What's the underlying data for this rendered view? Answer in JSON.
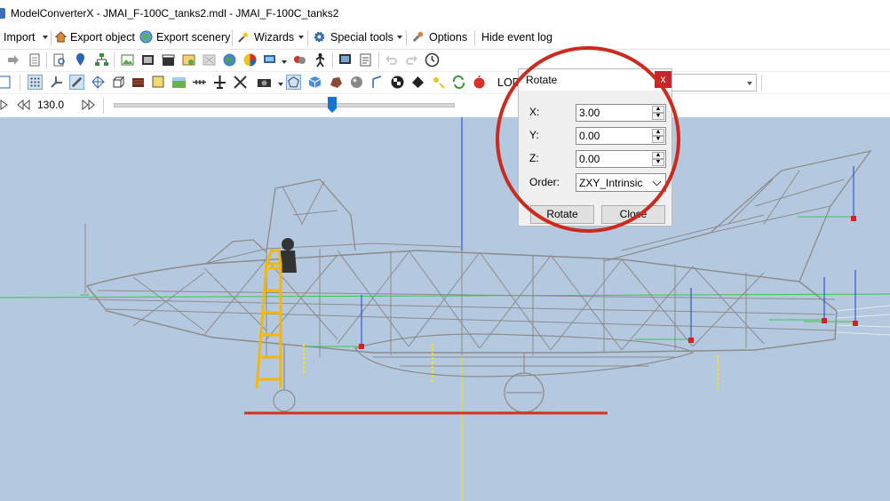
{
  "window": {
    "title": "ModelConverterX - JMAI_F-100C_tanks2.mdl - JMAI_F-100C_tanks2"
  },
  "menu": {
    "import": "Import",
    "export_object": "Export object",
    "export_scenery": "Export scenery",
    "wizards": "Wizards",
    "special_tools": "Special tools",
    "options": "Options",
    "hide_event_log": "Hide event log"
  },
  "toolbar": {
    "lod_label": "LOD",
    "playback_value": "130.0"
  },
  "rotate_dialog": {
    "title": "Rotate",
    "close_glyph": "x",
    "x_label": "X:",
    "x_value": "3.00",
    "y_label": "Y:",
    "y_value": "0.00",
    "z_label": "Z:",
    "z_value": "0.00",
    "order_label": "Order:",
    "order_value": "ZXY_Intrinsic",
    "rotate_button": "Rotate",
    "close_button": "Close"
  },
  "colors": {
    "viewport_bg": "#b4c9e0",
    "wireframe": "#8c8c8c",
    "highlight_circle": "#cc2a1e",
    "ladder": "#f2b70a",
    "ground_line": "#d93025"
  }
}
